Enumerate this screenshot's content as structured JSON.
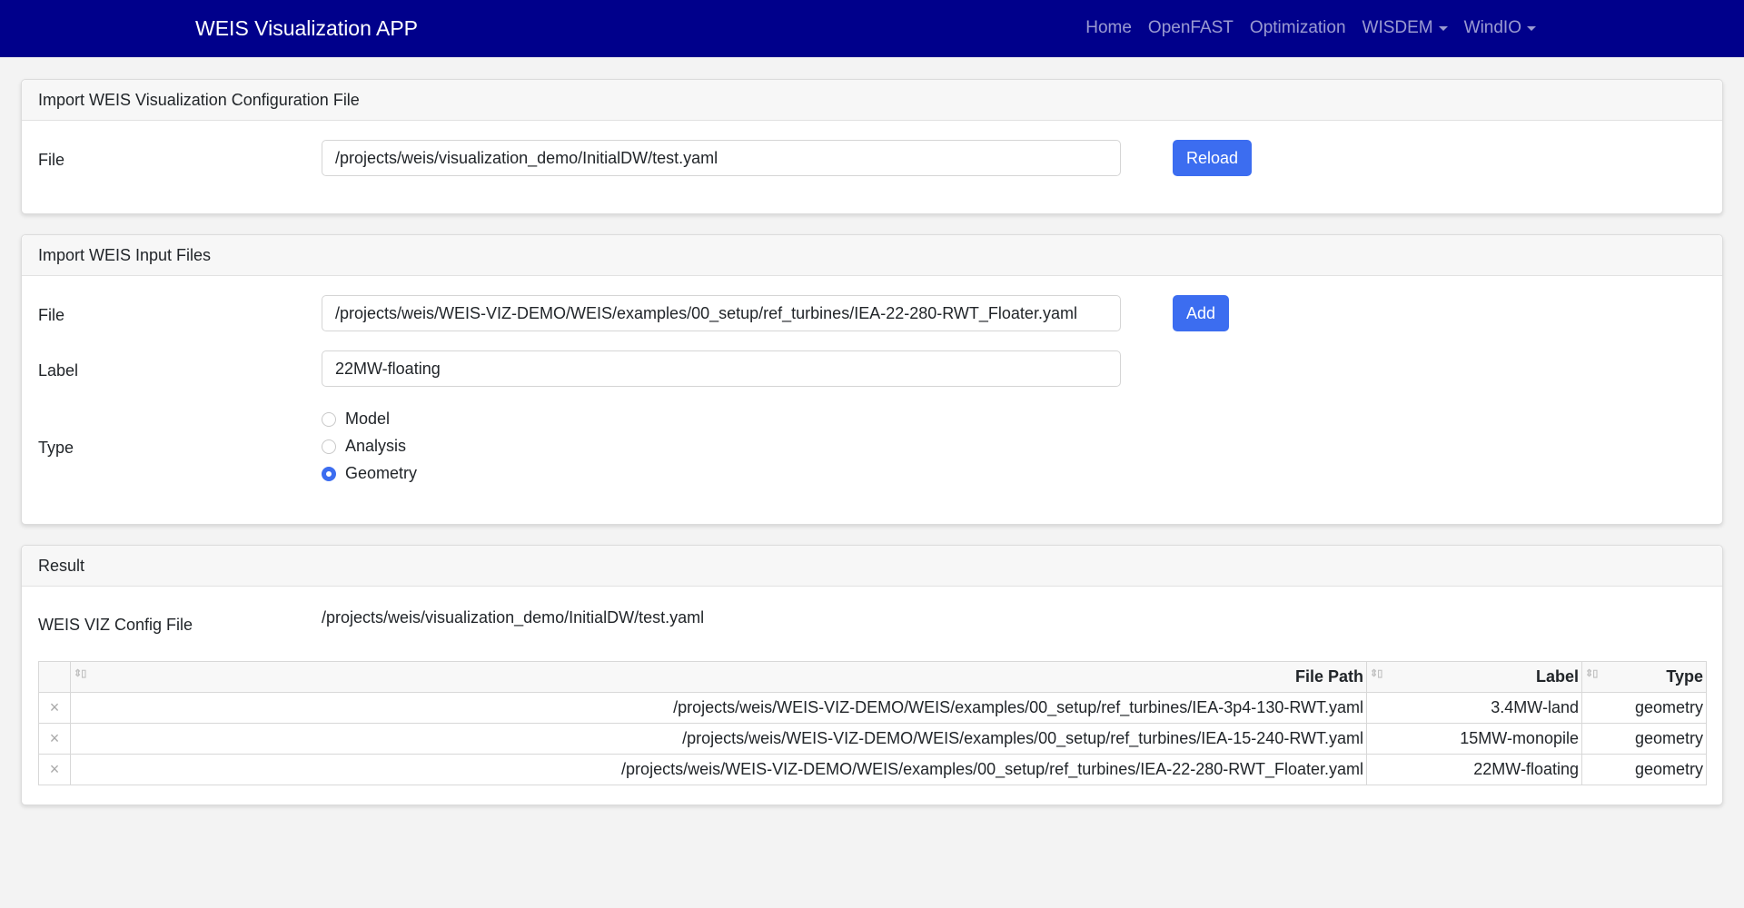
{
  "navbar": {
    "brand": "WEIS Visualization APP",
    "links": [
      {
        "label": "Home",
        "dropdown": false
      },
      {
        "label": "OpenFAST",
        "dropdown": false
      },
      {
        "label": "Optimization",
        "dropdown": false
      },
      {
        "label": "WISDEM",
        "dropdown": true
      },
      {
        "label": "WindIO",
        "dropdown": true
      }
    ]
  },
  "config_card": {
    "header": "Import WEIS Visualization Configuration File",
    "file_label": "File",
    "file_value": "/projects/weis/visualization_demo/InitialDW/test.yaml",
    "reload_button": "Reload"
  },
  "input_card": {
    "header": "Import WEIS Input Files",
    "file_label": "File",
    "file_value": "/projects/weis/WEIS-VIZ-DEMO/WEIS/examples/00_setup/ref_turbines/IEA-22-280-RWT_Floater.yaml",
    "add_button": "Add",
    "label_label": "Label",
    "label_value": "22MW-floating",
    "type_label": "Type",
    "type_options": [
      "Model",
      "Analysis",
      "Geometry"
    ],
    "type_selected": "Geometry"
  },
  "result_card": {
    "header": "Result",
    "config_label": "WEIS VIZ Config File",
    "config_value": "/projects/weis/visualization_demo/InitialDW/test.yaml",
    "columns": [
      "File Path",
      "Label",
      "Type"
    ],
    "rows": [
      {
        "file_path": "/projects/weis/WEIS-VIZ-DEMO/WEIS/examples/00_setup/ref_turbines/IEA-3p4-130-RWT.yaml",
        "label": "3.4MW-land",
        "type": "geometry"
      },
      {
        "file_path": "/projects/weis/WEIS-VIZ-DEMO/WEIS/examples/00_setup/ref_turbines/IEA-15-240-RWT.yaml",
        "label": "15MW-monopile",
        "type": "geometry"
      },
      {
        "file_path": "/projects/weis/WEIS-VIZ-DEMO/WEIS/examples/00_setup/ref_turbines/IEA-22-280-RWT_Floater.yaml",
        "label": "22MW-floating",
        "type": "geometry"
      }
    ],
    "delete_glyph": "×"
  },
  "colors": {
    "navbar": "#00008b",
    "primary_button": "#3c6df0"
  }
}
